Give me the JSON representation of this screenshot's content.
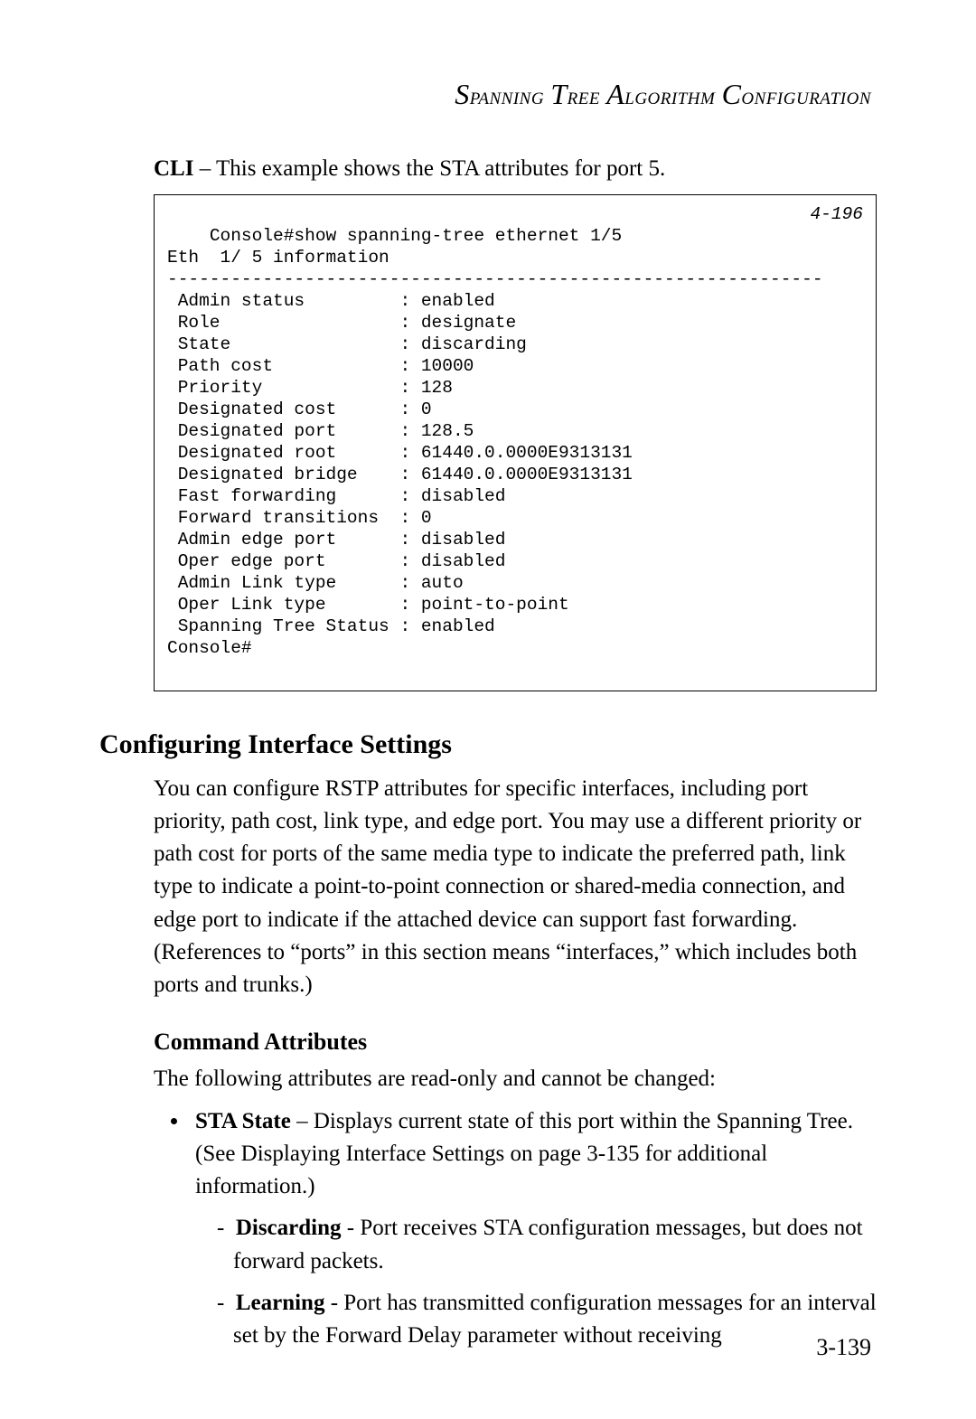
{
  "header": {
    "text": "Spanning Tree Algorithm Configuration"
  },
  "cli": {
    "intro_bold": "CLI",
    "intro_rest": " – This example shows the STA attributes for port 5.",
    "ref": "4-196",
    "output": "Console#show spanning-tree ethernet 1/5\nEth  1/ 5 information\n--------------------------------------------------------------\n Admin status         : enabled\n Role                 : designate\n State                : discarding\n Path cost            : 10000\n Priority             : 128\n Designated cost      : 0\n Designated port      : 128.5\n Designated root      : 61440.0.0000E9313131\n Designated bridge    : 61440.0.0000E9313131\n Fast forwarding      : disabled\n Forward transitions  : 0\n Admin edge port      : disabled\n Oper edge port       : disabled\n Admin Link type      : auto\n Oper Link type       : point-to-point\n Spanning Tree Status : enabled\nConsole#"
  },
  "section": {
    "heading": "Configuring Interface Settings",
    "paragraph": "You can configure RSTP attributes for specific interfaces, including port priority, path cost, link type, and edge port. You may use a different priority or path cost for ports of the same media type to indicate the preferred path, link type to indicate a point-to-point connection or shared-media connection, and edge port to indicate if the attached device can support fast forwarding. (References to “ports” in this section means “interfaces,” which includes both ports and trunks.)"
  },
  "attributes": {
    "heading": "Command Attributes",
    "intro": "The following attributes are read-only and cannot be changed:",
    "item": {
      "label": "STA State",
      "desc": " – Displays current state of this port within the Spanning Tree. (See Displaying Interface Settings on page 3-135 for additional information.)"
    },
    "sub": [
      {
        "label": "Discarding",
        "desc": " - Port receives STA configuration messages, but does not forward packets."
      },
      {
        "label": "Learning",
        "desc": " - Port has transmitted configuration messages for an interval set by the Forward Delay parameter without receiving"
      }
    ]
  },
  "page_number": "3-139"
}
